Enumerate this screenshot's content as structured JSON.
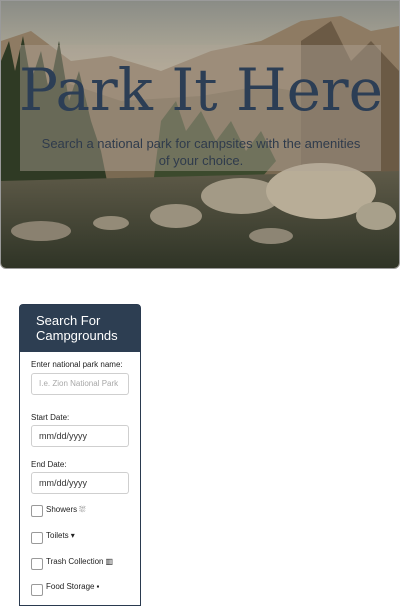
{
  "hero": {
    "title": "Park It Here",
    "subtitle": "Search a national park for campsites with the amenities of your choice."
  },
  "search_panel": {
    "heading": "Search For Campgrounds",
    "park_label": "Enter national park name:",
    "park_placeholder": "I.e. Zion National Park",
    "start_label": "Start Date:",
    "start_value": "mm/dd/yyyy",
    "end_label": "End Date:",
    "end_value": "mm/dd/yyyy",
    "amenities": [
      {
        "label": "Showers",
        "icon": "shower-icon",
        "glyph": "⛆",
        "checked": false
      },
      {
        "label": "Toilets",
        "icon": "toilet-icon",
        "glyph": "▾",
        "checked": false
      },
      {
        "label": "Trash Collection",
        "icon": "trash-icon",
        "glyph": "▥",
        "checked": false
      },
      {
        "label": "Food Storage",
        "icon": "food-storage-icon",
        "glyph": "▪",
        "checked": false
      }
    ]
  },
  "colors": {
    "panel_header": "#2d3e52",
    "title_text": "#2c3e55"
  }
}
